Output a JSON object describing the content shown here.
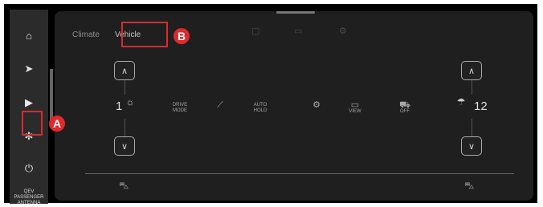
{
  "sidebar": {
    "items": [
      {
        "icon": "home-icon",
        "glyph": "⌂"
      },
      {
        "icon": "navigation-icon",
        "glyph": "➤"
      },
      {
        "icon": "media-play-icon",
        "glyph": "▶"
      },
      {
        "icon": "fan-icon",
        "glyph": "✻"
      },
      {
        "icon": "power-icon",
        "glyph": "⏻"
      }
    ],
    "brand": {
      "line1": "QEV",
      "line2": "PASSENGER",
      "line3": "ANTENNA"
    }
  },
  "annotations": {
    "a": "A",
    "b": "B"
  },
  "tabs": {
    "climate": "Climate",
    "vehicle": "Vehicle",
    "active": "Vehicle"
  },
  "left_control": {
    "value": "1"
  },
  "right_control": {
    "value": "12"
  },
  "functions": [
    {
      "name": "drive-mode",
      "label": "DRIVE\nMODE",
      "icon": ""
    },
    {
      "name": "lane-assist",
      "label": "",
      "icon": "⟋"
    },
    {
      "name": "auto-hold",
      "label": "AUTO\nHOLD",
      "icon": ""
    },
    {
      "name": "parking-assist",
      "label": "",
      "icon": "⚙"
    },
    {
      "name": "view",
      "label": "VIEW",
      "icon": "▭"
    },
    {
      "name": "esc-off",
      "label": "OFF",
      "icon": "⛟"
    }
  ],
  "colors": {
    "accent": "#e0282d",
    "panel": "#1f1f1f",
    "sidebar": "#2b2b2b"
  }
}
